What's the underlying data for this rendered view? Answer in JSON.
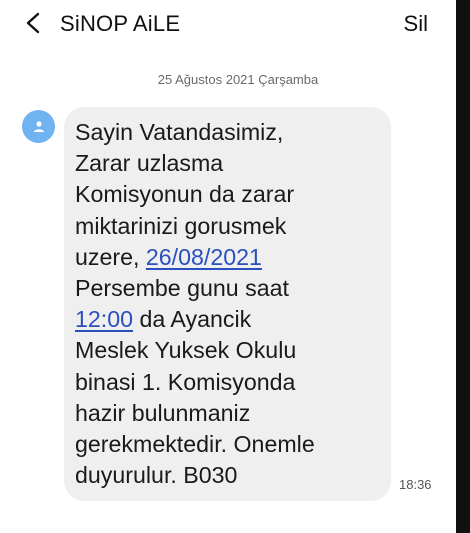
{
  "header": {
    "title": "SiNOP AiLE",
    "delete_label": "Sil",
    "back_icon": "chevron-left-icon"
  },
  "conversation": {
    "date_separator": "25 Ağustos 2021 Çarşamba"
  },
  "message": {
    "sender_avatar_icon": "person-icon",
    "avatar_color": "#6fb3f0",
    "link_color": "#2a4fbf",
    "bubble_color": "#efefef",
    "lines": {
      "l1": "Sayin Vatandasimiz,",
      "l2": "Zarar uzlasma",
      "l3": "Komisyonun da zarar",
      "l4": "miktarinizi gorusmek",
      "l5_prefix": "uzere, ",
      "l5_date_link": "26/08/2021",
      "l6": "Persembe gunu saat",
      "l7_time_link": "12:00",
      "l7_suffix": " da Ayancik",
      "l8": "Meslek Yuksek Okulu",
      "l9": "binasi 1. Komisyonda",
      "l10": "hazir bulunmaniz",
      "l11": "gerekmektedir. Onemle",
      "l12": "duyurulur. B030"
    },
    "timestamp": "18:36"
  }
}
